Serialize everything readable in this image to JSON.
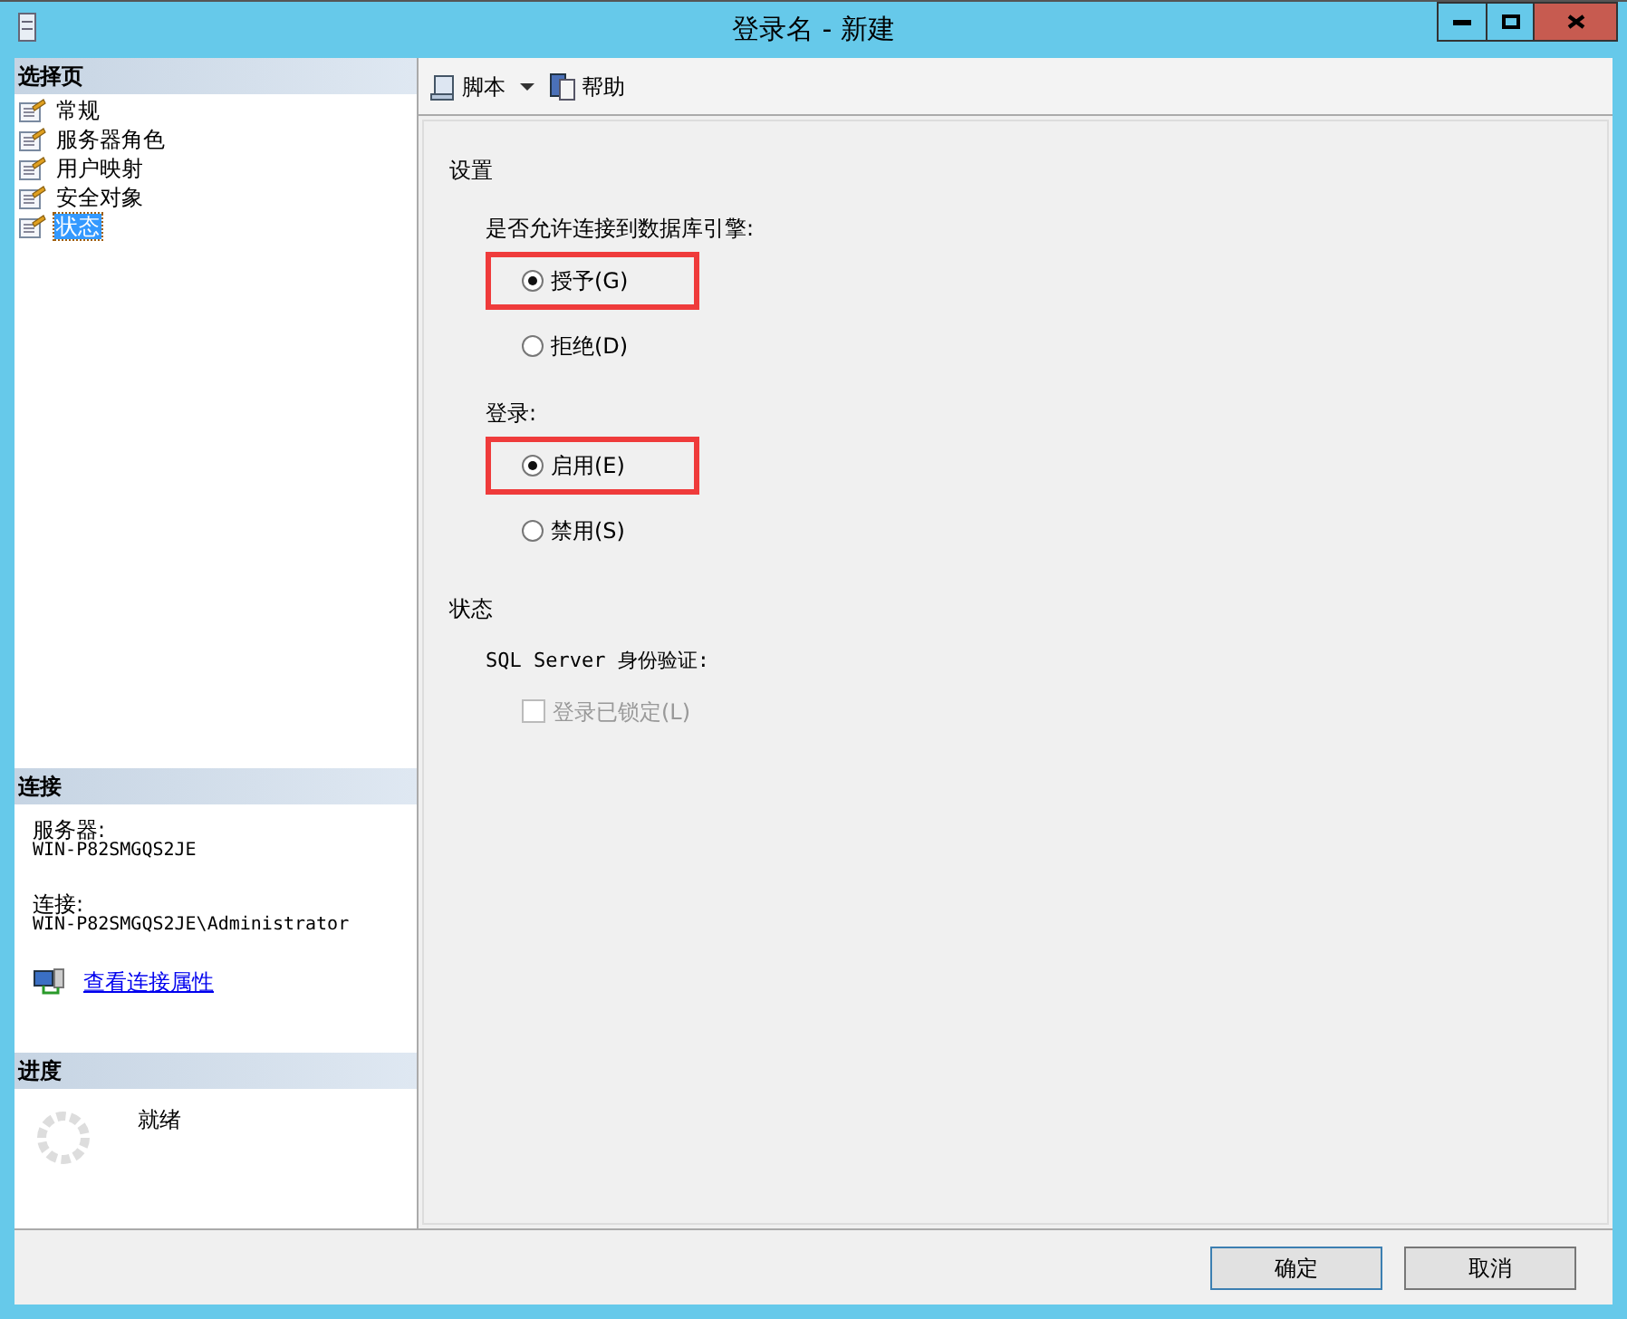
{
  "window": {
    "title": "登录名 - 新建"
  },
  "sidebar": {
    "header": "选择页",
    "items": [
      {
        "label": "常规",
        "selected": false
      },
      {
        "label": "服务器角色",
        "selected": false
      },
      {
        "label": "用户映射",
        "selected": false
      },
      {
        "label": "安全对象",
        "selected": false
      },
      {
        "label": "状态",
        "selected": true
      }
    ]
  },
  "connection": {
    "header": "连接",
    "server_label": "服务器:",
    "server": "WIN-P82SMGQS2JE",
    "connection_label": "连接:",
    "connection": "WIN-P82SMGQS2JE\\Administrator",
    "link": "查看连接属性"
  },
  "progress": {
    "header": "进度",
    "status": "就绪"
  },
  "toolbar": {
    "script": "脚本",
    "help": "帮助"
  },
  "settings": {
    "header": "设置",
    "groups": [
      {
        "label": "是否允许连接到数据库引擎:",
        "options": [
          {
            "label": "授予(G)",
            "selected": true,
            "highlighted": true
          },
          {
            "label": "拒绝(D)",
            "selected": false,
            "highlighted": false
          }
        ]
      },
      {
        "label": "登录:",
        "options": [
          {
            "label": "启用(E)",
            "selected": true,
            "highlighted": true
          },
          {
            "label": "禁用(S)",
            "selected": false,
            "highlighted": false
          }
        ]
      }
    ]
  },
  "status": {
    "header": "状态",
    "auth_label": "SQL Server 身份验证:",
    "locked": {
      "label": "登录已锁定(L)",
      "checked": false,
      "disabled": true
    }
  },
  "buttons": [
    {
      "label": "确定",
      "default": true
    },
    {
      "label": "取消",
      "default": false
    }
  ]
}
